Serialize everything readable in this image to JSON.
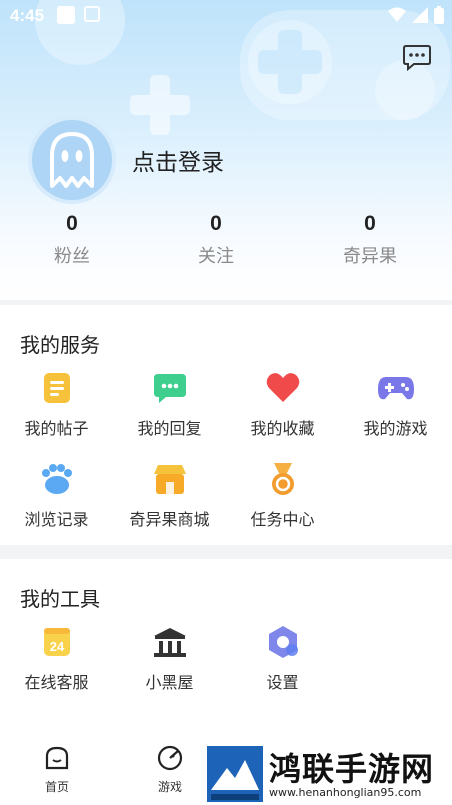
{
  "status_bar": {
    "time": "4:45"
  },
  "profile": {
    "login_text": "点击登录",
    "stats": [
      {
        "value": "0",
        "label": "粉丝"
      },
      {
        "value": "0",
        "label": "关注"
      },
      {
        "value": "0",
        "label": "奇异果"
      }
    ]
  },
  "services": {
    "title": "我的服务",
    "items": [
      {
        "label": "我的帖子",
        "icon": "post-icon"
      },
      {
        "label": "我的回复",
        "icon": "reply-icon"
      },
      {
        "label": "我的收藏",
        "icon": "heart-icon"
      },
      {
        "label": "我的游戏",
        "icon": "gamepad-icon"
      },
      {
        "label": "浏览记录",
        "icon": "paw-icon"
      },
      {
        "label": "奇异果商城",
        "icon": "shop-icon"
      },
      {
        "label": "任务中心",
        "icon": "medal-icon"
      }
    ]
  },
  "tools": {
    "title": "我的工具",
    "items": [
      {
        "label": "在线客服",
        "icon": "service-24-icon",
        "badge": "24"
      },
      {
        "label": "小黑屋",
        "icon": "bank-icon"
      },
      {
        "label": "设置",
        "icon": "settings-icon"
      }
    ]
  },
  "tabbar": {
    "tabs": [
      {
        "label": "首页",
        "icon": "home-icon"
      },
      {
        "label": "游戏",
        "icon": "game-tab-icon"
      }
    ]
  },
  "watermark": {
    "title": "鸿联手游网",
    "url": "www.henanhonglian95.com"
  }
}
